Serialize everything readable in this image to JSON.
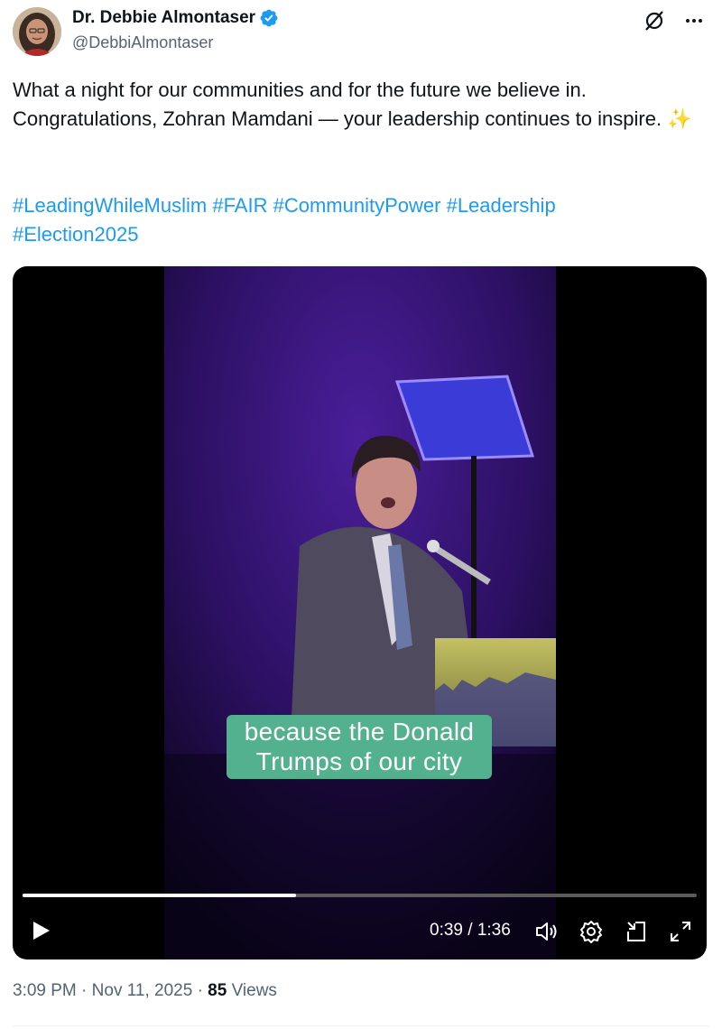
{
  "author": {
    "display_name": "Dr. Debbie Almontaser",
    "handle": "@DebbiAlmontaser",
    "verified": true
  },
  "tweet": {
    "text": "What a night for our communities and for the future we believe in. Congratulations, Zohran Mamdani — your leadership continues to inspire. ✨",
    "hashtags_line1": [
      "#LeadingWhileMuslim",
      "#FAIR",
      "#CommunityPower",
      "#Leadership"
    ],
    "hashtags_line2": [
      "#Election2025"
    ]
  },
  "video": {
    "caption_line1": "because the Donald",
    "caption_line2": "Trumps of our city",
    "current_time": "0:39",
    "duration": "1:36",
    "time_display": "0:39 / 1:36",
    "progress_fraction": 0.406
  },
  "meta": {
    "time": "3:09 PM",
    "separator": "·",
    "date": "Nov 11, 2025",
    "views_count": "85",
    "views_label": "Views"
  },
  "colors": {
    "link": "#1d9bf0",
    "verified": "#1d9bf0",
    "caption_bg": "#54b18f",
    "secondary_text": "#536471"
  },
  "icons": {
    "top": [
      "grok-slash-icon",
      "more-icon"
    ],
    "controls": [
      "play-icon",
      "volume-icon",
      "settings-icon",
      "picture-in-picture-icon",
      "fullscreen-icon"
    ]
  }
}
